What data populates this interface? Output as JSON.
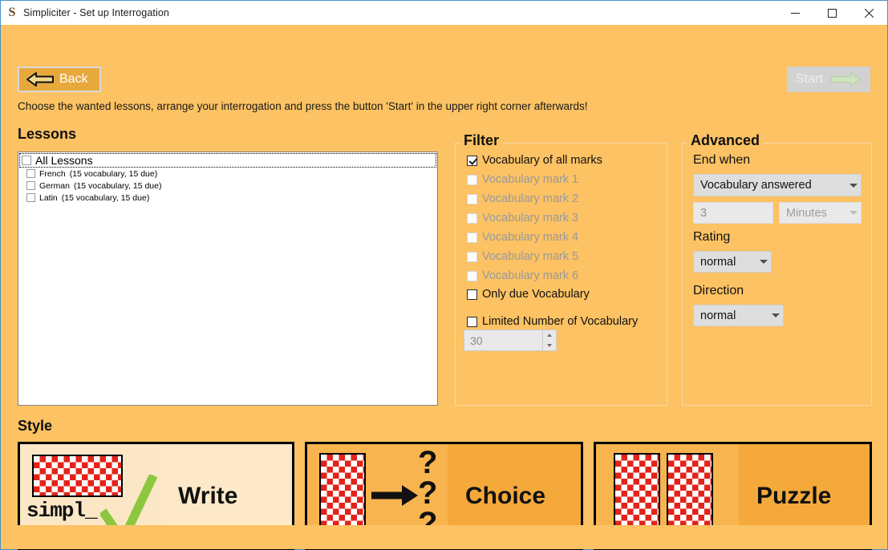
{
  "window": {
    "logo": "S",
    "title": "Simpliciter  -  Set up Interrogation",
    "minimize_icon": "—",
    "maximize_icon": "▢",
    "close_icon": "✕"
  },
  "toolbar": {
    "back_label": "Back",
    "back_icon": "left-arrow-icon",
    "start_label": "Start",
    "start_icon": "right-arrow-icon",
    "start_enabled": false
  },
  "instruction": "Choose the wanted lessons, arrange your interrogation and press the button 'Start' in the upper right corner afterwards!",
  "lessons": {
    "heading": "Lessons",
    "all_label": "All Lessons",
    "items": [
      {
        "label": "French",
        "detail": "(15 vocabulary, 15 due)"
      },
      {
        "label": "German",
        "detail": "(15 vocabulary, 15 due)"
      },
      {
        "label": "Latin",
        "detail": "(15 vocabulary, 15 due)"
      }
    ]
  },
  "filter": {
    "heading": "Filter",
    "all_marks_label": "Vocabulary of all marks",
    "marks": [
      "Vocabulary mark 1",
      "Vocabulary mark 2",
      "Vocabulary mark 3",
      "Vocabulary mark 4",
      "Vocabulary mark 5",
      "Vocabulary mark 6"
    ],
    "only_due_label": "Only due Vocabulary",
    "limited_label": "Limited Number of Vocabulary",
    "limit_value": "30"
  },
  "advanced": {
    "heading": "Advanced",
    "end_when_label": "End when",
    "end_when_value": "Vocabulary answered",
    "duration_value": "3",
    "unit_value": "Minutes",
    "rating_label": "Rating",
    "rating_value": "normal",
    "direction_label": "Direction",
    "direction_value": "normal"
  },
  "style": {
    "heading": "Style",
    "cards": [
      {
        "label": "Write",
        "caption": "simpl_"
      },
      {
        "label": "Choice",
        "qmarks": "?"
      },
      {
        "label": "Puzzle"
      }
    ]
  },
  "colors": {
    "background": "#fcc263",
    "card_red": "#e2231a",
    "accent_orange": "#f5a93a",
    "check_green": "#8dc63f"
  }
}
